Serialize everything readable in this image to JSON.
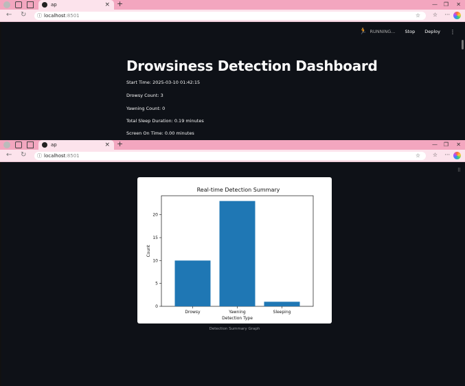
{
  "browser": {
    "tab_title": "ap",
    "url_host": "localhost",
    "url_port": ":8501"
  },
  "header": {
    "status": "RUNNING...",
    "stop_label": "Stop",
    "deploy_label": "Deploy"
  },
  "dashboard": {
    "title": "Drowsiness Detection Dashboard",
    "stats": [
      "Start Time: 2025-03-10 01:42:15",
      "Drowsy Count: 3",
      "Yawning Count: 0",
      "Total Sleep Duration: 0.19 minutes",
      "Screen On Time: 0.00 minutes"
    ]
  },
  "chart_caption": "Detection Summary Graph",
  "chart_data": {
    "type": "bar",
    "title": "Real-time Detection Summary",
    "xlabel": "Detection Type",
    "ylabel": "Count",
    "categories": [
      "Drowsy",
      "Yawning",
      "Sleeping"
    ],
    "values": [
      10,
      23,
      1
    ],
    "ylim": [
      0,
      24.15
    ],
    "yticks": [
      0,
      5,
      10,
      15,
      20
    ],
    "bar_color": "#1f77b4",
    "grid": false
  }
}
